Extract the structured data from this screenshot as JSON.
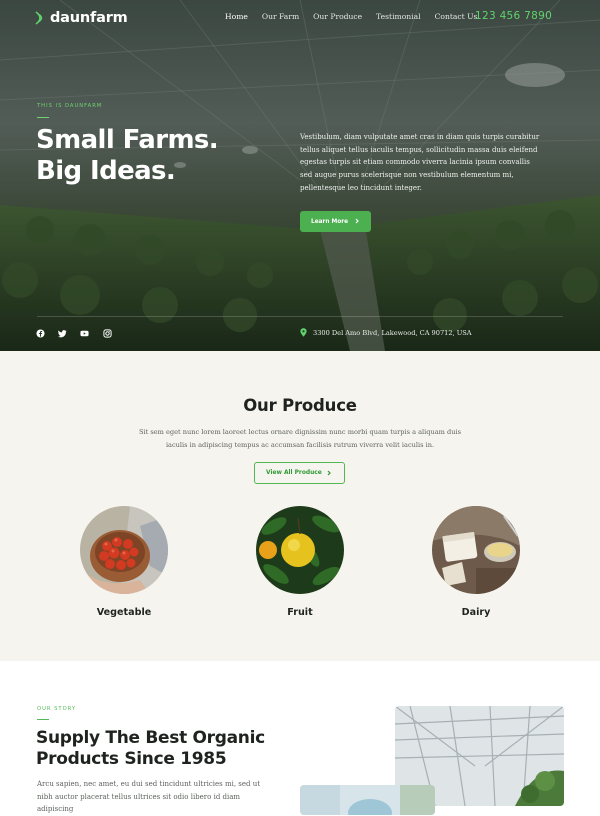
{
  "nav": {
    "logo": "daunfarm",
    "links": [
      "Home",
      "Our Farm",
      "Our Produce",
      "Testimonial",
      "Contact Us"
    ],
    "active": "Home",
    "phone": "123 456 7890"
  },
  "hero": {
    "eyebrow": "THIS IS DAUNFARM",
    "title_line1": "Small Farms.",
    "title_line2": "Big Ideas.",
    "description": "Vestibulum, diam vulputate amet cras in diam quis turpis curabitur tellus aliquet tellus iaculis tempus, sollicitudin massa duis eleifend egestas turpis sit etiam commodo viverra lacinia ipsum convallis sed augue purus scelerisque non vestibulum elementum mi, pellentesque leo tincidunt integer.",
    "button_label": "Learn More",
    "social_icons": [
      "facebook-icon",
      "twitter-icon",
      "youtube-icon",
      "instagram-icon"
    ],
    "address": "3300 Del Amo Blvd, Lakewood, CA 90712, USA"
  },
  "produce": {
    "title": "Our Produce",
    "description": "Sit sem eget nunc lorem laoreet lectus ornare dignissim nunc morbi quam turpis a aliquam duis iaculis in adipiscing tempus ac accumsan facilisis rutrum viverra velit iaculis in.",
    "button_label": "View All Produce",
    "items": [
      {
        "label": "Vegetable",
        "image": "tomatoes-in-bowl"
      },
      {
        "label": "Fruit",
        "image": "lemons-on-branch"
      },
      {
        "label": "Dairy",
        "image": "cheese-and-milk"
      }
    ]
  },
  "story": {
    "eyebrow": "OUR STORY",
    "title_line1": "Supply The Best Organic",
    "title_line2": "Products Since 1985",
    "body": "Arcu sapien, nec amet, eu dui sed tincidunt ultricies mi, sed ut nibh auctor placerat tellus ultrices sit odio libero id diam adipiscing"
  },
  "colors": {
    "accent": "#4caf50",
    "phone": "#5fd36b",
    "produce_bg": "#f6f4ee"
  }
}
